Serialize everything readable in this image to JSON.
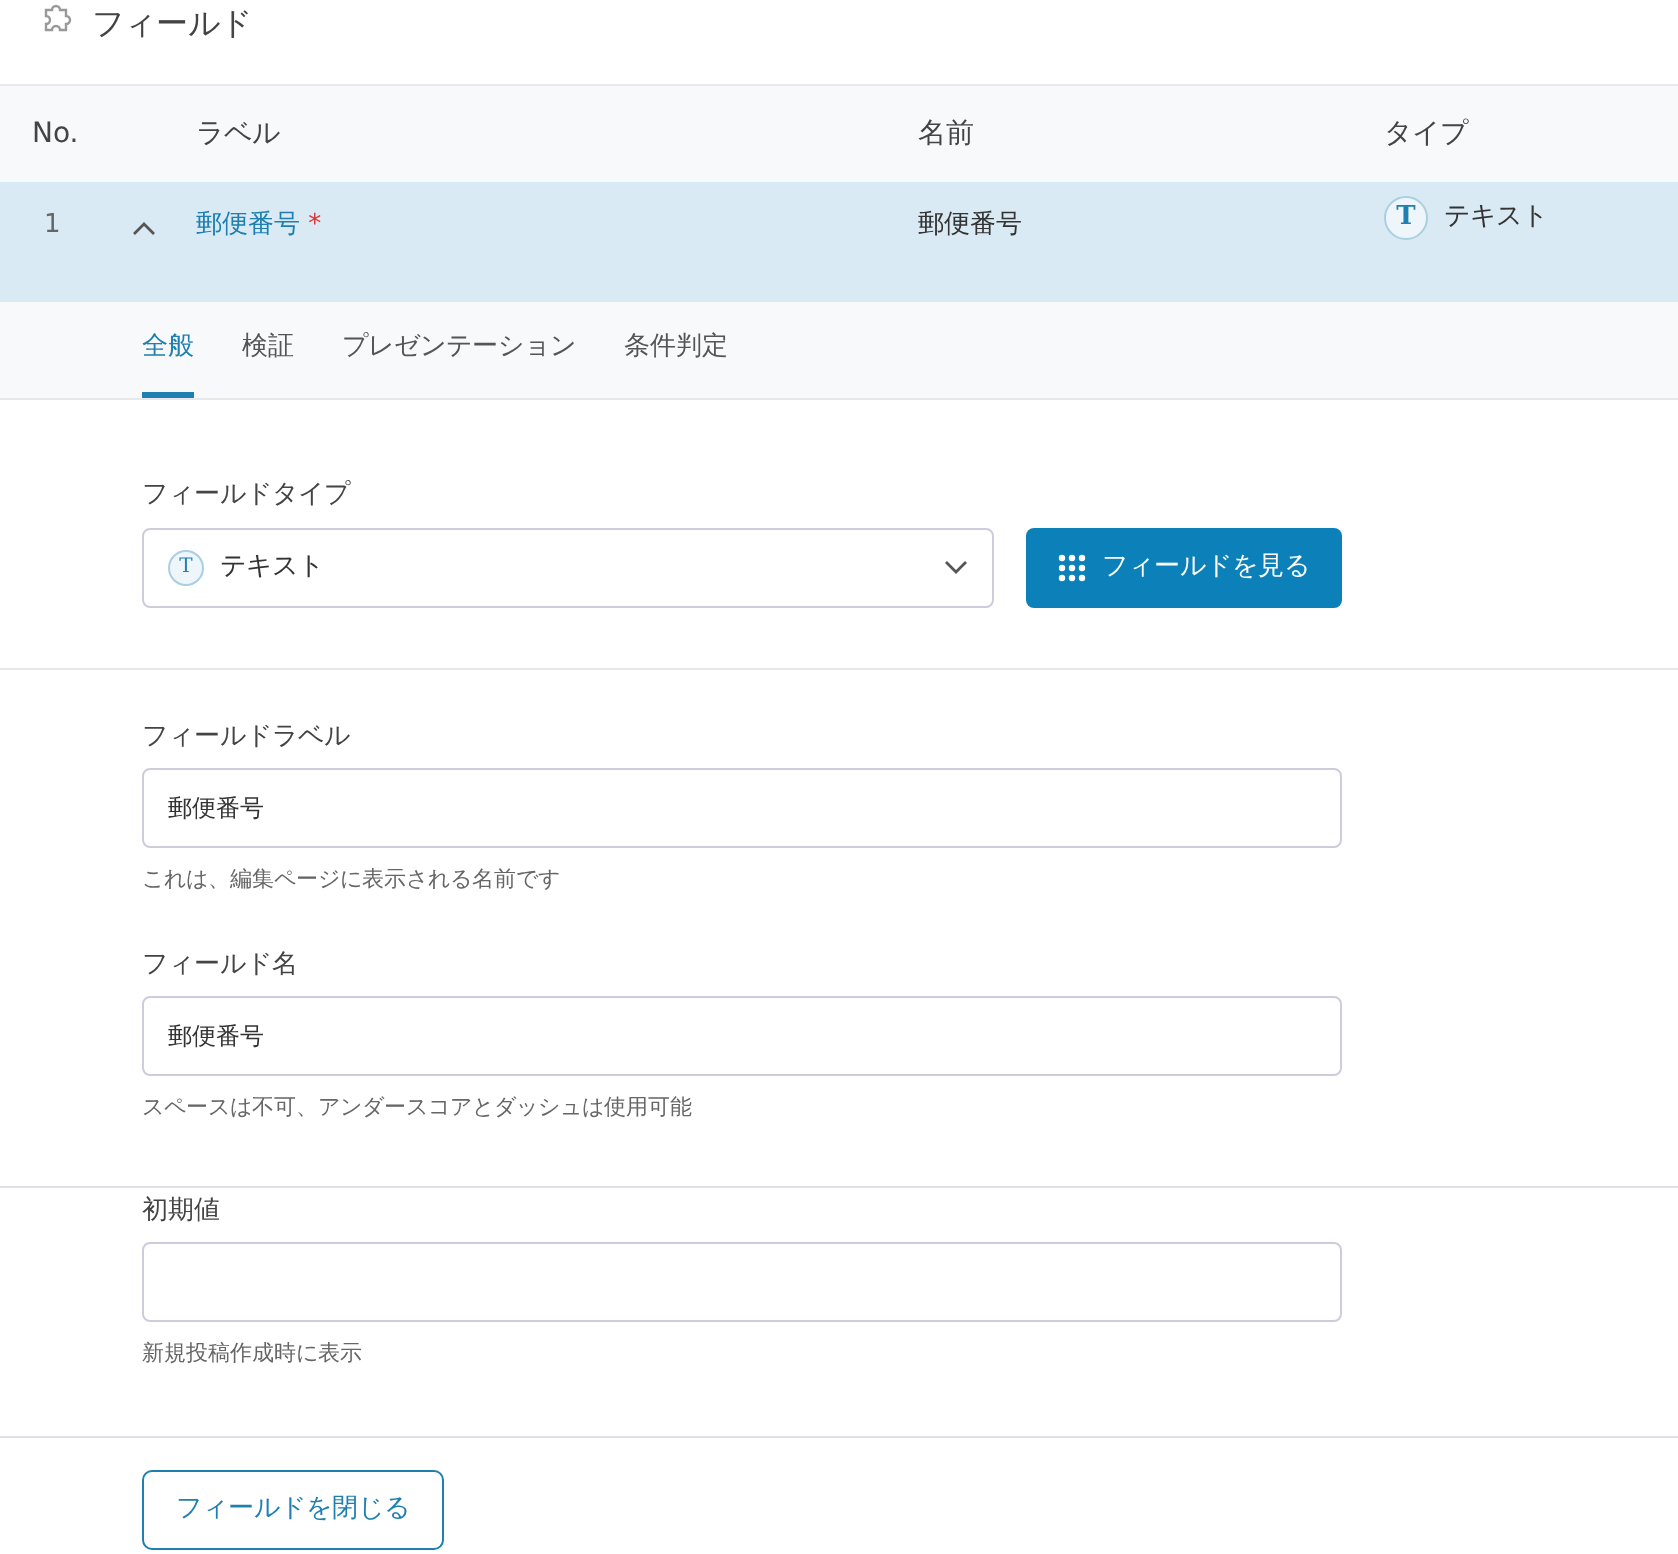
{
  "header": {
    "title": "フィールド"
  },
  "table": {
    "columns": [
      "No.",
      "ラベル",
      "名前",
      "タイプ"
    ],
    "rows": [
      {
        "no": "1",
        "expanded": true,
        "label": "郵便番号",
        "required": true,
        "required_mark": "*",
        "name": "郵便番号",
        "type_icon": "T",
        "type": "テキスト"
      }
    ]
  },
  "tabs": [
    {
      "label": "全般",
      "selected": true
    },
    {
      "label": "検証",
      "selected": false
    },
    {
      "label": "プレゼンテーション",
      "selected": false
    },
    {
      "label": "条件判定",
      "selected": false
    }
  ],
  "field_type": {
    "label": "フィールドタイプ",
    "icon": "T",
    "value": "テキスト",
    "button": "フィールドを見る"
  },
  "fields": [
    {
      "label": "フィールドラベル",
      "value": "郵便番号",
      "help": "これは、編集ページに表示される名前です"
    },
    {
      "label": "フィールド名",
      "value": "郵便番号",
      "help": "スペースは不可、アンダースコアとダッシュは使用可能"
    },
    {
      "label": "初期値",
      "help": "新規投稿作成時に表示"
    }
  ],
  "close_button": "フィールドを閉じる"
}
